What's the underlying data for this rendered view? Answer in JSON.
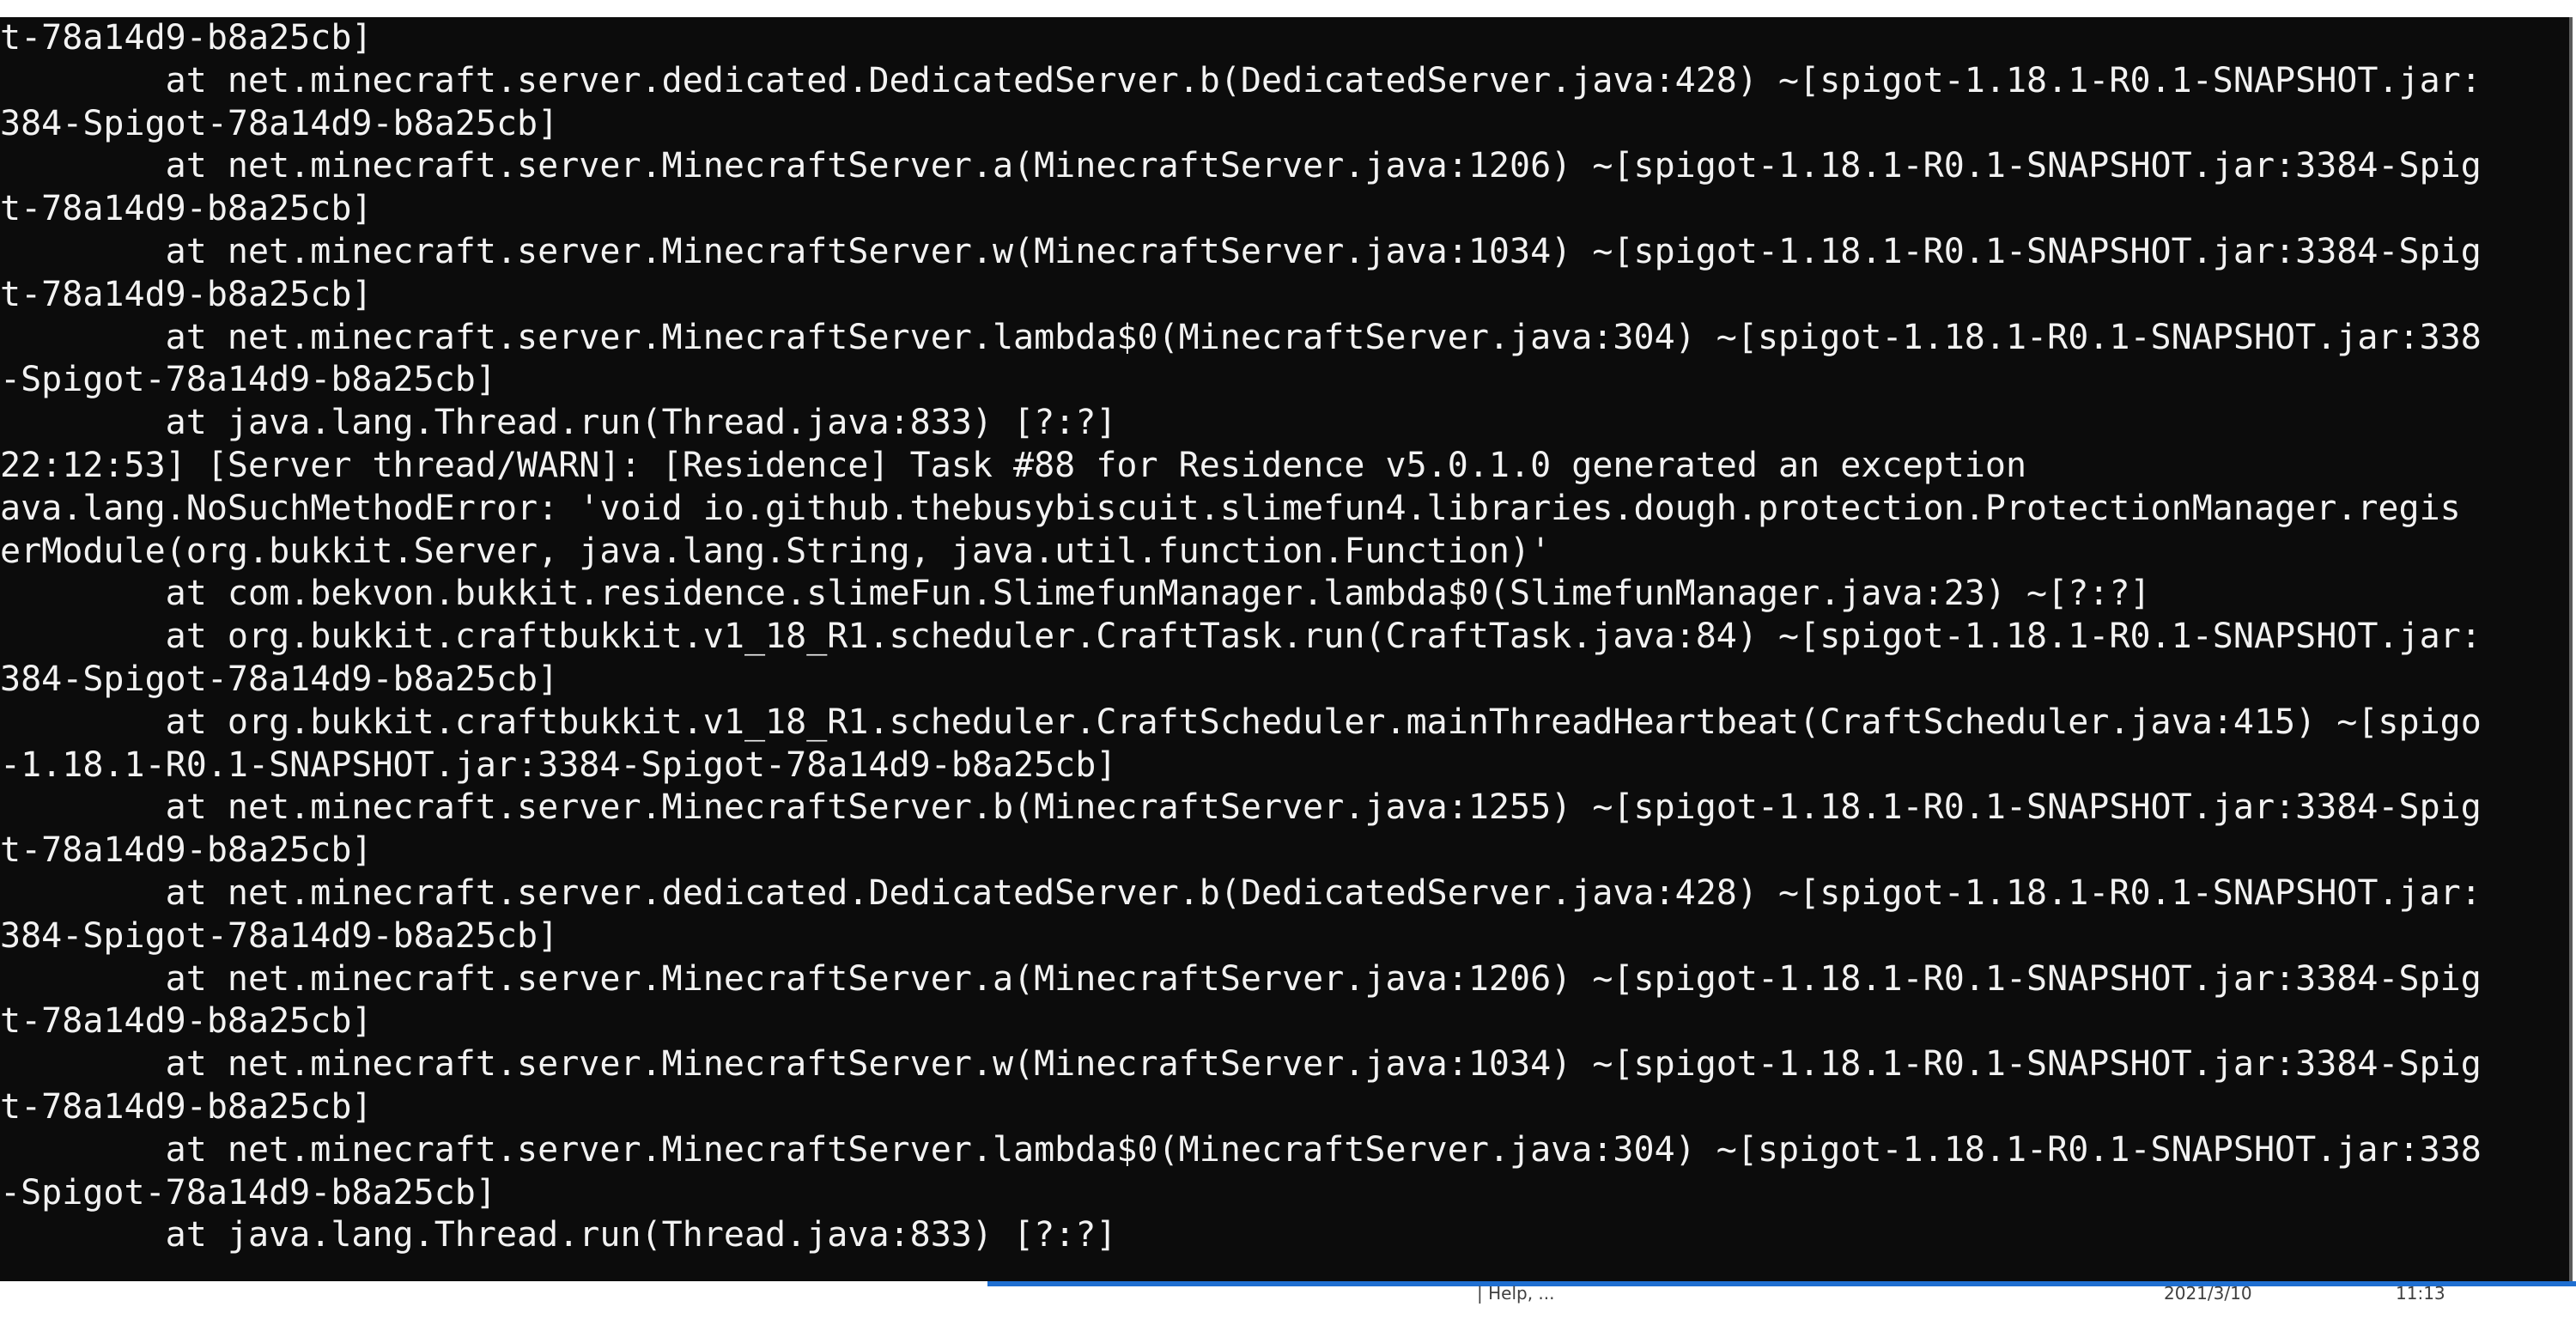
{
  "window": {
    "type": "console",
    "colors": {
      "background": "#0c0c0c",
      "text": "#f2f2f2",
      "taskbar_accent": "#1f6fd1"
    }
  },
  "console": {
    "lines": [
      "t-78a14d9-b8a25cb]",
      "        at net.minecraft.server.dedicated.DedicatedServer.b(DedicatedServer.java:428) ~[spigot-1.18.1-R0.1-SNAPSHOT.jar:",
      "384-Spigot-78a14d9-b8a25cb]",
      "        at net.minecraft.server.MinecraftServer.a(MinecraftServer.java:1206) ~[spigot-1.18.1-R0.1-SNAPSHOT.jar:3384-Spig",
      "t-78a14d9-b8a25cb]",
      "        at net.minecraft.server.MinecraftServer.w(MinecraftServer.java:1034) ~[spigot-1.18.1-R0.1-SNAPSHOT.jar:3384-Spig",
      "t-78a14d9-b8a25cb]",
      "        at net.minecraft.server.MinecraftServer.lambda$0(MinecraftServer.java:304) ~[spigot-1.18.1-R0.1-SNAPSHOT.jar:338",
      "-Spigot-78a14d9-b8a25cb]",
      "        at java.lang.Thread.run(Thread.java:833) [?:?]",
      "22:12:53] [Server thread/WARN]: [Residence] Task #88 for Residence v5.0.1.0 generated an exception",
      "ava.lang.NoSuchMethodError: 'void io.github.thebusybiscuit.slimefun4.libraries.dough.protection.ProtectionManager.regis",
      "erModule(org.bukkit.Server, java.lang.String, java.util.function.Function)'",
      "        at com.bekvon.bukkit.residence.slimeFun.SlimefunManager.lambda$0(SlimefunManager.java:23) ~[?:?]",
      "        at org.bukkit.craftbukkit.v1_18_R1.scheduler.CraftTask.run(CraftTask.java:84) ~[spigot-1.18.1-R0.1-SNAPSHOT.jar:",
      "384-Spigot-78a14d9-b8a25cb]",
      "        at org.bukkit.craftbukkit.v1_18_R1.scheduler.CraftScheduler.mainThreadHeartbeat(CraftScheduler.java:415) ~[spigo",
      "-1.18.1-R0.1-SNAPSHOT.jar:3384-Spigot-78a14d9-b8a25cb]",
      "        at net.minecraft.server.MinecraftServer.b(MinecraftServer.java:1255) ~[spigot-1.18.1-R0.1-SNAPSHOT.jar:3384-Spig",
      "t-78a14d9-b8a25cb]",
      "        at net.minecraft.server.dedicated.DedicatedServer.b(DedicatedServer.java:428) ~[spigot-1.18.1-R0.1-SNAPSHOT.jar:",
      "384-Spigot-78a14d9-b8a25cb]",
      "        at net.minecraft.server.MinecraftServer.a(MinecraftServer.java:1206) ~[spigot-1.18.1-R0.1-SNAPSHOT.jar:3384-Spig",
      "t-78a14d9-b8a25cb]",
      "        at net.minecraft.server.MinecraftServer.w(MinecraftServer.java:1034) ~[spigot-1.18.1-R0.1-SNAPSHOT.jar:3384-Spig",
      "t-78a14d9-b8a25cb]",
      "        at net.minecraft.server.MinecraftServer.lambda$0(MinecraftServer.java:304) ~[spigot-1.18.1-R0.1-SNAPSHOT.jar:338",
      "-Spigot-78a14d9-b8a25cb]",
      "        at java.lang.Thread.run(Thread.java:833) [?:?]"
    ]
  },
  "taskbar": {
    "item_label": "| Help, ...",
    "date": "2021/3/10",
    "time": "11:13"
  }
}
